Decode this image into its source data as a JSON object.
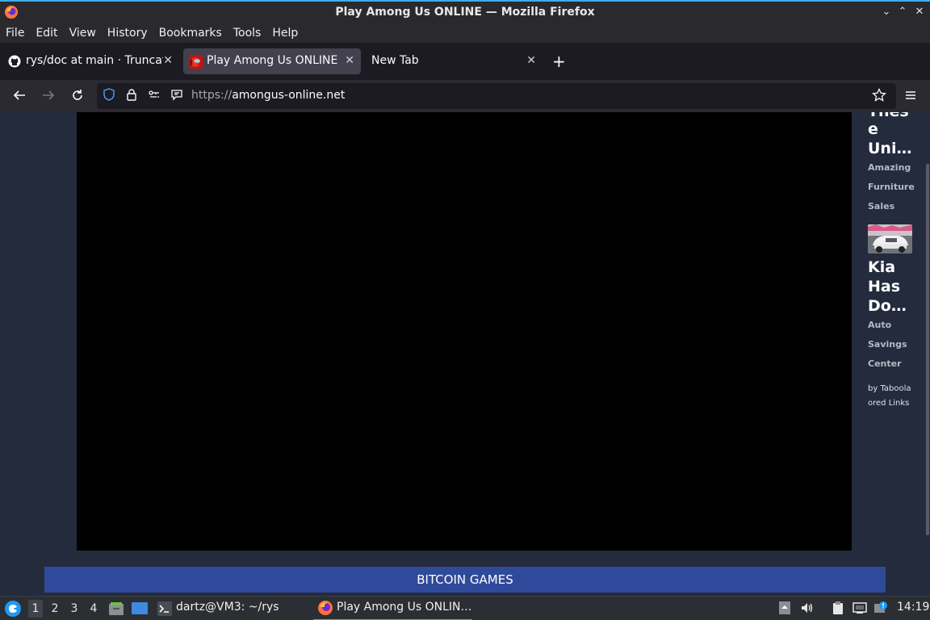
{
  "window": {
    "title": "Play Among Us ONLINE — Mozilla Firefox",
    "controls": {
      "minimize": "⌄",
      "maximize": "⌃",
      "close": "✕"
    }
  },
  "menu": [
    "File",
    "Edit",
    "View",
    "History",
    "Bookmarks",
    "Tools",
    "Help"
  ],
  "tabs": [
    {
      "label": "rys/doc at main · Truncat",
      "icon": "github-icon",
      "active": false
    },
    {
      "label": "Play Among Us ONLINE",
      "icon": "among-us-icon",
      "active": true
    },
    {
      "label": "New Tab",
      "icon": "",
      "active": false
    }
  ],
  "navbar": {
    "url_scheme": "https://",
    "url_host": "amongus-online.net"
  },
  "sidebar": {
    "head1_lines": [
      "Thes",
      "e",
      "Uni…"
    ],
    "sub1_lines": [
      "Amazing",
      "Furniture",
      "Sales"
    ],
    "head2_lines": [
      "Kia",
      "Has",
      "Do…"
    ],
    "sub2_lines": [
      "Auto",
      "Savings",
      "Center"
    ],
    "taboola": "by Taboola",
    "sponsored": "ored Links"
  },
  "banner": {
    "label": "BITCOIN GAMES"
  },
  "taskbar": {
    "workspaces": [
      "1",
      "2",
      "3",
      "4"
    ],
    "active_workspace": "1",
    "terminal_label": "dartz@VM3: ~/rys",
    "firefox_label": "Play Among Us ONLIN…",
    "clock": "14:19"
  }
}
